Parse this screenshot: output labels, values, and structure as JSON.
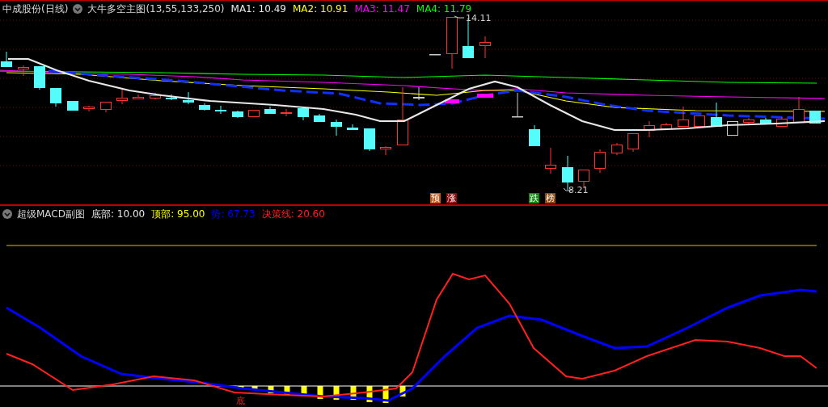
{
  "main_panel": {
    "stock": "中成股份(日线)",
    "indicator": "大牛多空主图(13,55,133,250)",
    "ma": [
      {
        "label": "MA1:",
        "value": "10.49",
        "color": "#e8e8e8"
      },
      {
        "label": "MA2:",
        "value": "10.91",
        "color": "#ffff00"
      },
      {
        "label": "MA3:",
        "value": "11.47",
        "color": "#ff00ff"
      },
      {
        "label": "MA4:",
        "value": "11.79",
        "color": "#00ff00"
      }
    ],
    "price_labels": [
      {
        "text": "14.11",
        "kind": "high"
      },
      {
        "text": "8.21",
        "kind": "low"
      }
    ],
    "signals": [
      {
        "text": "预",
        "color": "#c0561a"
      },
      {
        "text": "涨",
        "color": "#8b0a0a"
      },
      {
        "text": "跌",
        "color": "#0d8a0d"
      },
      {
        "text": "榜",
        "color": "#8b4a12"
      }
    ]
  },
  "sub_panel": {
    "indicator": "超级MACD副图",
    "readings": [
      {
        "label": "底部:",
        "value": "10.00",
        "color": "#e8e8e8"
      },
      {
        "label": "顶部:",
        "value": "95.00",
        "color": "#ffff00"
      },
      {
        "label": "势:",
        "value": "67.73",
        "color": "#0000ff"
      },
      {
        "label": "决策线:",
        "value": "20.60",
        "color": "#ff2020"
      }
    ],
    "marker": "底"
  }
}
